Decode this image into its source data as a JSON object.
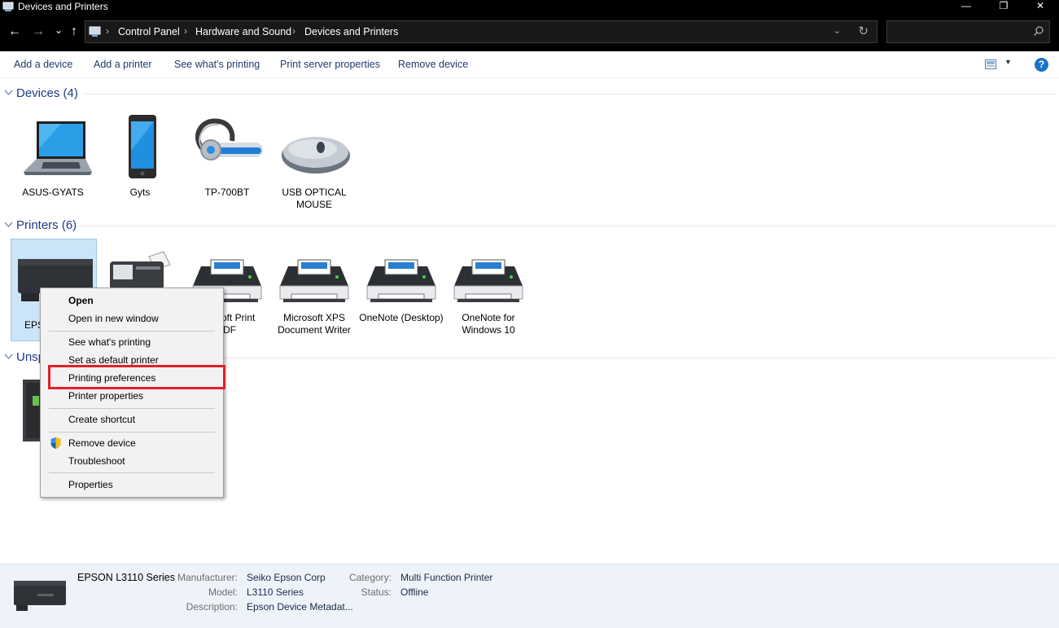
{
  "window": {
    "title": "Devices and Printers",
    "minimize": "—",
    "maximize": "❐",
    "close": "✕"
  },
  "nav": {
    "back": "←",
    "forward": "→",
    "recent": "⌄",
    "up": "↑"
  },
  "address": {
    "crumbs": [
      "Control Panel",
      "Hardware and Sound",
      "Devices and Printers"
    ],
    "separator": "›",
    "dropdown": "⌄",
    "refresh": "↻"
  },
  "search": {
    "placeholder": "",
    "value": ""
  },
  "commands": [
    "Add a device",
    "Add a printer",
    "See what's printing",
    "Print server properties",
    "Remove device"
  ],
  "help_label": "?",
  "view_dropdown": "▼",
  "groups": {
    "devices": {
      "title": "Devices (4)",
      "items": [
        {
          "label": "ASUS-GYATS",
          "icon": "laptop-icon"
        },
        {
          "label": "Gyts",
          "icon": "phone-icon"
        },
        {
          "label": "TP-700BT",
          "icon": "headset-icon"
        },
        {
          "label": "USB OPTICAL MOUSE",
          "icon": "mouse-icon"
        }
      ]
    },
    "printers": {
      "title": "Printers (6)",
      "items": [
        {
          "label": "EPSON L3110 Series",
          "visible_label": "EPS",
          "icon": "epson-printer-icon",
          "selected": true
        },
        {
          "label": "Fax",
          "icon": "fax-icon"
        },
        {
          "label": "Microsoft Print to PDF",
          "visible_label": "soft Print PDF",
          "icon": "printer-icon"
        },
        {
          "label": "Microsoft XPS Document Writer",
          "icon": "printer-icon"
        },
        {
          "label": "OneNote (Desktop)",
          "icon": "printer-icon"
        },
        {
          "label": "OneNote for Windows 10",
          "icon": "printer-icon"
        }
      ]
    },
    "unspecified": {
      "title": "Unspecified",
      "visible_title": "Unsp"
    }
  },
  "context_menu": {
    "items": [
      {
        "label": "Open",
        "bold": true
      },
      {
        "label": "Open in new window"
      },
      {
        "label": "See what's printing"
      },
      {
        "label": "Set as default printer"
      },
      {
        "label": "Printing preferences",
        "highlighted": true
      },
      {
        "label": "Printer properties"
      },
      {
        "label": "Create shortcut"
      },
      {
        "label": "Remove device",
        "icon": "uac-shield-icon"
      },
      {
        "label": "Troubleshoot"
      },
      {
        "label": "Properties"
      }
    ]
  },
  "details": {
    "name": "EPSON L3110 Series",
    "manufacturer_label": "Manufacturer:",
    "manufacturer": "Seiko Epson Corp",
    "model_label": "Model:",
    "model": "L3110 Series",
    "description_label": "Description:",
    "description": "Epson Device Metadat...",
    "category_label": "Category:",
    "category": "Multi Function Printer",
    "status_label": "Status:",
    "status": "Offline"
  },
  "colors": {
    "accent": "#1e3a8a",
    "selection": "#cce4f7",
    "highlight_box": "#e0202a",
    "details_bg": "#eef3f9"
  }
}
